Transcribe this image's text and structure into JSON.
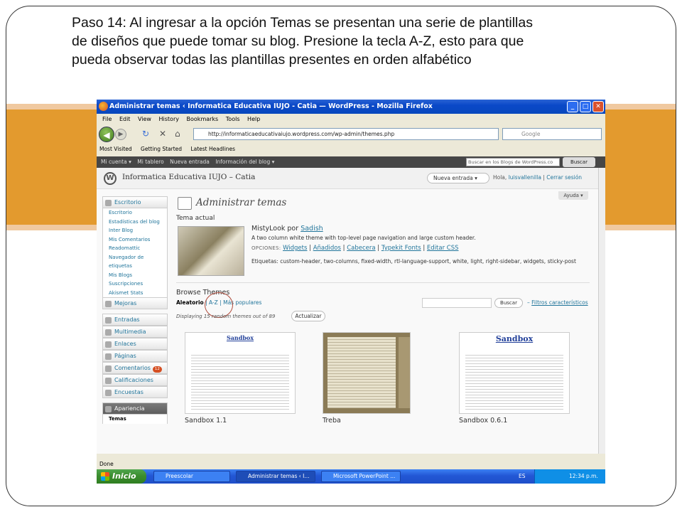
{
  "slide": {
    "caption_lines": [
      "Paso 14: Al ingresar a la opción Temas  se presentan una serie de plantillas",
      "de diseños que puede tomar su blog.  Presione la tecla A-Z, esto para que",
      "pueda observar todas las plantillas presentes en orden alfabético"
    ]
  },
  "browser": {
    "title": "Administrar temas ‹ Informatica Educativa IUJO - Catia — WordPress - Mozilla Firefox",
    "menu": [
      "File",
      "Edit",
      "View",
      "History",
      "Bookmarks",
      "Tools",
      "Help"
    ],
    "url": "http://informaticaeducativaiujo.wordpress.com/wp-admin/themes.php",
    "search_placeholder": "Google",
    "bookmarks": [
      "Most Visited",
      "Getting Started",
      "Latest Headlines"
    ],
    "status": "Done"
  },
  "wpbar": {
    "items": [
      "Mi cuenta ▾",
      "Mi tablero",
      "Nueva entrada",
      "Información del blog ▾"
    ],
    "search_placeholder": "Buscar en los Blogs de WordPress.co",
    "search_button": "Buscar"
  },
  "header": {
    "site_name": "Informatica Educativa IUJO – Catia",
    "new_entry": "Nueva entrada",
    "howdy_prefix": "Hola,",
    "user": "luisvallenilla",
    "logout": "Cerrar sesión",
    "help": "Ayuda ▾"
  },
  "sidebar": {
    "escritorio": "Escritorio",
    "escritorio_items": [
      "Escritorio",
      "Estadísticas del blog",
      "Inter Blog",
      "Mis Comentarios",
      "Readomattic",
      "Navegador de etiquetas",
      "Mis Blogs",
      "Suscripciones",
      "Akismet Stats"
    ],
    "mejoras": "Mejoras",
    "entradas": "Entradas",
    "multimedia": "Multimedia",
    "enlaces": "Enlaces",
    "paginas": "Páginas",
    "comentarios": "Comentarios",
    "comentarios_count": "12",
    "calificaciones": "Calificaciones",
    "encuestas": "Encuestas",
    "apariencia": "Apariencia",
    "temas": "Temas"
  },
  "main": {
    "page_title": "Administrar temas",
    "current_heading": "Tema actual",
    "current_theme_name": "MistyLook por",
    "current_theme_author": "Sadish",
    "current_theme_desc": "A two column white theme with top-level page navigation and large custom header.",
    "options_label": "OPCIONES:",
    "options": [
      "Widgets",
      "Añadidos",
      "Cabecera",
      "Typekit Fonts",
      "Editar CSS"
    ],
    "tags": "Etiquetas: custom-header, two-columns, fixed-width, rtl-language-support, white, light, right-sidebar, widgets, sticky-post",
    "browse_heading": "Browse Themes",
    "tab_random": "Aleatorio",
    "tab_az": "A-Z",
    "tab_popular": "Más populares",
    "search_button": "Buscar",
    "featured_link": "Filtros característicos",
    "displaying": "Displaying 15 random themes out of 89",
    "update_button": "Actualizar",
    "themes": [
      {
        "name": "Sandbox 1.1",
        "thumb_title": "Sandbox"
      },
      {
        "name": "Treba",
        "thumb_title": ""
      },
      {
        "name": "Sandbox 0.6.1",
        "thumb_title": "Sandbox"
      }
    ]
  },
  "taskbar": {
    "start": "Inicio",
    "tasks": [
      "Preescolar",
      "Administrar temas ‹ I...",
      "Microsoft PowerPoint ..."
    ],
    "lang": "ES",
    "clock": "12:34 p.m."
  },
  "colors": {
    "accent_stripe": "#e39a2e",
    "wp_link": "#21759b",
    "xp_blue": "#2257d5"
  }
}
